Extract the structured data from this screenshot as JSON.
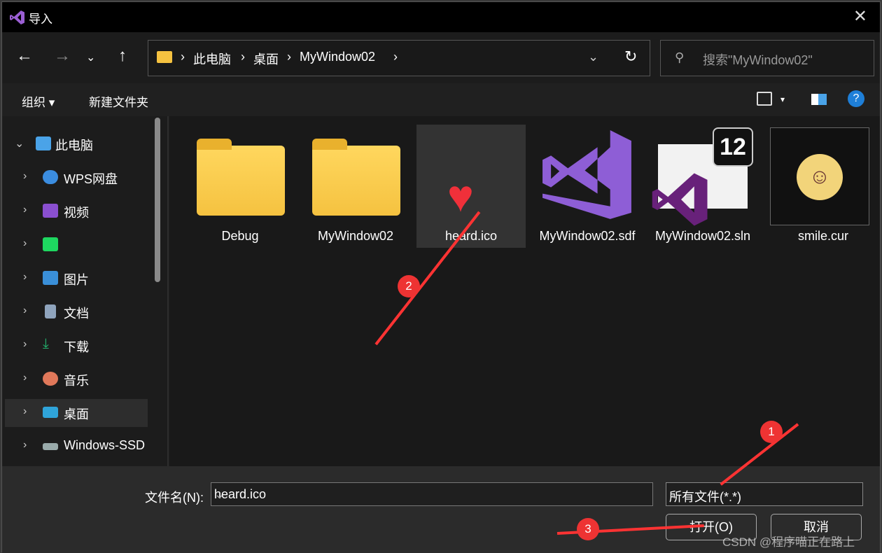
{
  "title": "导入",
  "breadcrumb": [
    "此电脑",
    "桌面",
    "MyWindow02"
  ],
  "search_placeholder": "搜索\"MyWindow02\"",
  "toolbar": {
    "organize": "组织",
    "new_folder": "新建文件夹",
    "help": "?"
  },
  "sidebar": [
    {
      "label": "此电脑",
      "icon": "computer-icon",
      "color": "#4aa3e8"
    },
    {
      "label": "WPS网盘",
      "icon": "cloud-icon",
      "color": "#3b8de0"
    },
    {
      "label": "视频",
      "icon": "video-icon",
      "color": "#8a4fd0"
    },
    {
      "label": "",
      "icon": "iqiyi-icon",
      "color": "#1ed760"
    },
    {
      "label": "图片",
      "icon": "pictures-icon",
      "color": "#3a8fd8"
    },
    {
      "label": "文档",
      "icon": "documents-icon",
      "color": "#8fa4bd"
    },
    {
      "label": "下载",
      "icon": "download-icon",
      "color": "#23b26d"
    },
    {
      "label": "音乐",
      "icon": "music-icon",
      "color": "#e0785a"
    },
    {
      "label": "桌面",
      "icon": "desktop-icon",
      "color": "#2fa4d9"
    },
    {
      "label": "Windows-SSD",
      "icon": "drive-icon",
      "color": "#9aa"
    }
  ],
  "files": [
    {
      "name": "Debug",
      "type": "folder"
    },
    {
      "name": "MyWindow02",
      "type": "folder"
    },
    {
      "name": "heard.ico",
      "type": "icon"
    },
    {
      "name": "MyWindow02.sdf",
      "type": "vs"
    },
    {
      "name": "MyWindow02.sln",
      "type": "sln",
      "badge": "12"
    },
    {
      "name": "smile.cur",
      "type": "cursor"
    }
  ],
  "bottom": {
    "filename_label": "文件名(N):",
    "filename_value": "heard.ico",
    "filter": "所有文件(*.*)",
    "open": "打开(O)",
    "cancel": "取消"
  },
  "annotations": [
    "1",
    "2",
    "3"
  ],
  "watermark": "CSDN @程序喵正在路上"
}
